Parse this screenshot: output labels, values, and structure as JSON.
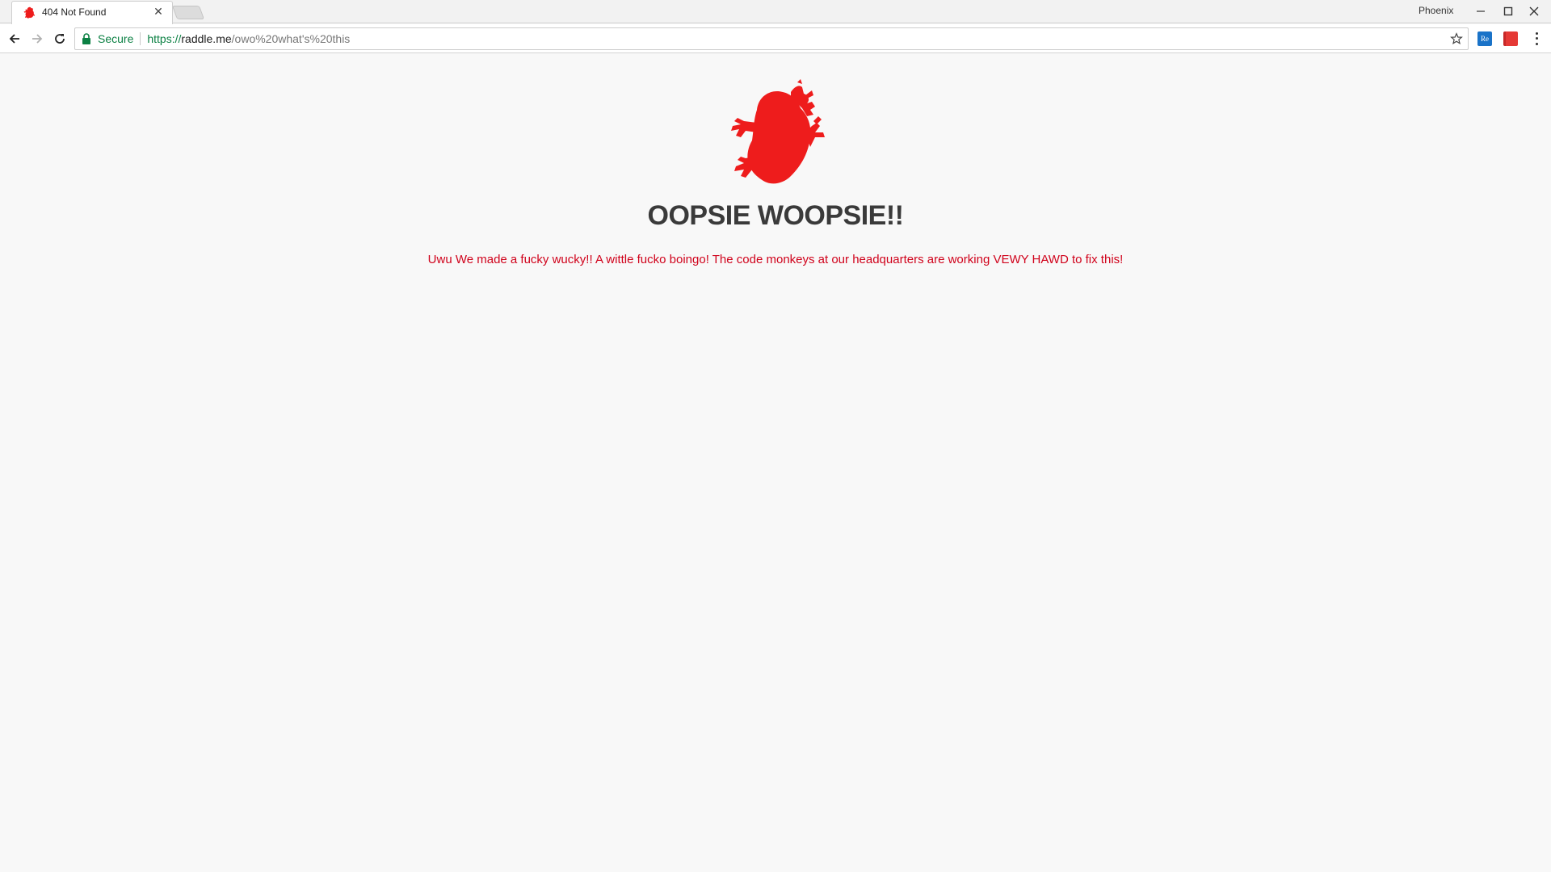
{
  "browser": {
    "tab": {
      "title": "404 Not Found",
      "close_glyph": "✕",
      "favicon": "frog-icon"
    },
    "profile_name": "Phoenix",
    "window_controls": {
      "minimize": "—",
      "maximize": "☐",
      "close": "✕"
    },
    "omnibox": {
      "security_label": "Secure",
      "url_scheme": "https://",
      "url_host": "raddle.me",
      "url_path": "/owo%20what's%20this"
    },
    "extensions": [
      {
        "name": "re-extension-icon",
        "label": "Re",
        "color": "#1a73c8"
      },
      {
        "name": "red-extension-icon",
        "label": "",
        "color": "#e53935"
      }
    ]
  },
  "page": {
    "headline": "OOPSIE WOOPSIE!!",
    "message": "Uwu We made a fucky wucky!! A wittle fucko boingo! The code monkeys at our headquarters are working VEWY HAWD to fix this!",
    "logo": "frog-icon"
  },
  "colors": {
    "brand_red": "#ee1c1c",
    "message_red": "#d0021b",
    "secure_green": "#0b8043"
  }
}
